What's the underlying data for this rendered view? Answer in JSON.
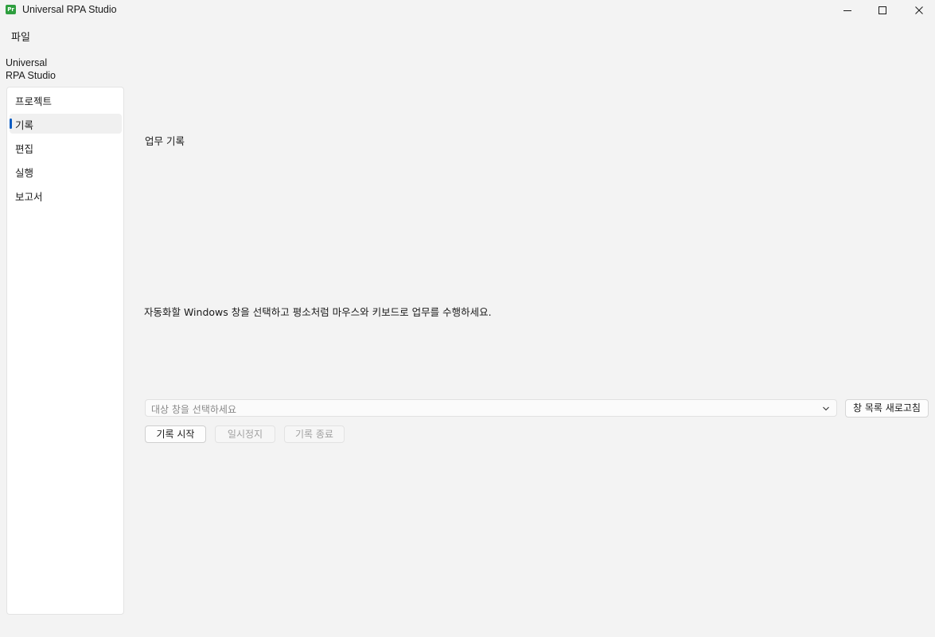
{
  "window": {
    "title": "Universal RPA Studio",
    "icon": "app-logo-icon",
    "icon_text": "Pr",
    "controls": [
      "minimize-icon",
      "maximize-icon",
      "close-icon"
    ]
  },
  "menu": {
    "items": [
      {
        "label": "파일"
      }
    ]
  },
  "brand": {
    "line1": "Universal",
    "line2": "RPA Studio"
  },
  "sidebar": {
    "items": [
      {
        "label": "프로젝트",
        "active": false
      },
      {
        "label": "기록",
        "active": true
      },
      {
        "label": "편집",
        "active": false
      },
      {
        "label": "실행",
        "active": false
      },
      {
        "label": "보고서",
        "active": false
      }
    ],
    "accent": "#0a5cc2"
  },
  "main": {
    "section_title": "업무 기록",
    "instruction": "자동화할 Windows 창을 선택하고 평소처럼 마우스와 키보드로 업무를 수행하세요.",
    "window_select": {
      "placeholder": "대상 창을 선택하세요",
      "icon": "chevron-down-icon"
    },
    "refresh_label": "창 목록 새로고침",
    "buttons": {
      "start": {
        "label": "기록 시작",
        "enabled": true
      },
      "pause": {
        "label": "일시정지",
        "enabled": false
      },
      "stop": {
        "label": "기록 종료",
        "enabled": false
      }
    }
  }
}
